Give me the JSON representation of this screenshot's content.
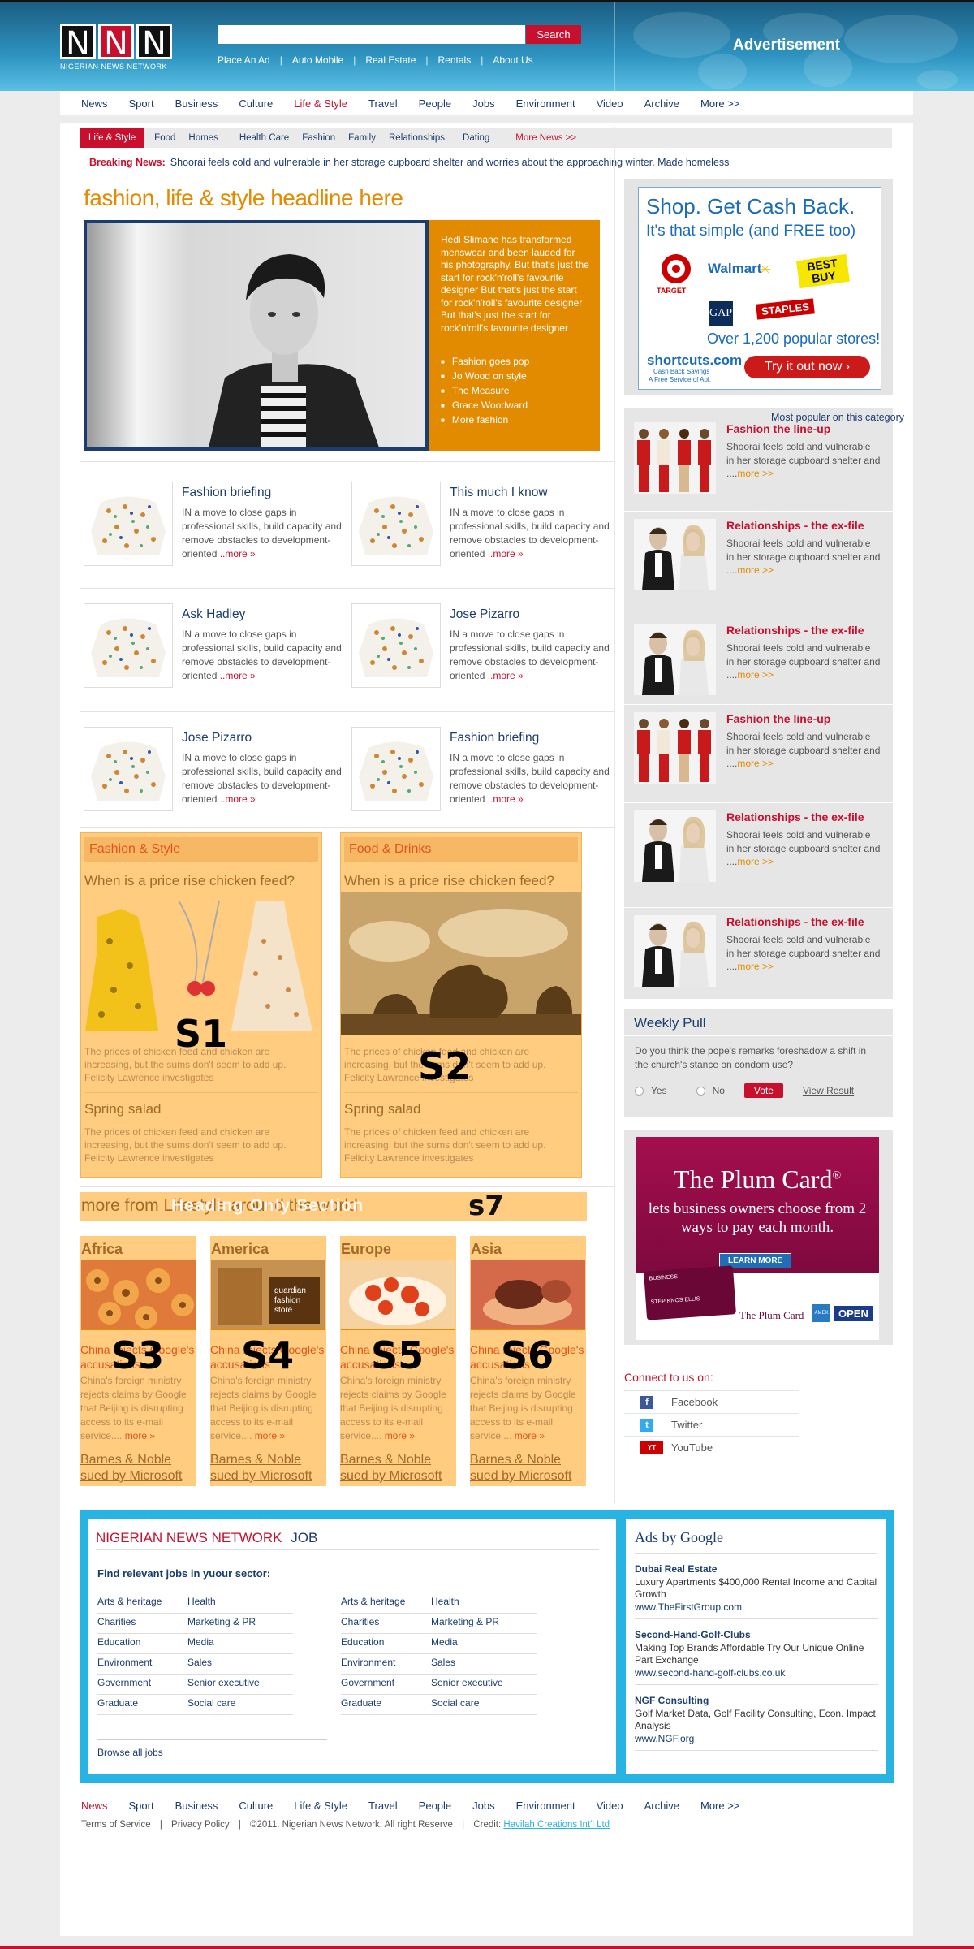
{
  "header": {
    "logo_letters": [
      "N",
      "N",
      "N"
    ],
    "logo_sub": "NIGERIAN NEWS NETWORK",
    "search_button": "Search",
    "search_value": "",
    "top_links": [
      "Place An Ad",
      "Auto Mobile",
      "Real Estate",
      "Rentals",
      "About Us"
    ],
    "advertisement": "Advertisement"
  },
  "main_nav": [
    "News",
    "Sport",
    "Business",
    "Culture",
    "Life & Style",
    "Travel",
    "People",
    "Jobs",
    "Environment",
    "Video",
    "Archive",
    "More >>"
  ],
  "main_nav_active": "Life & Style",
  "sub_nav": {
    "active": "Life & Style",
    "items": [
      "Food",
      "Homes",
      "Health Care",
      "Fashion",
      "Family",
      "Relationships",
      "Dating"
    ],
    "more": "More News >>"
  },
  "breaking": {
    "label": "Breaking News:",
    "text": "Shoorai feels cold and vulnerable in her storage cupboard shelter and worries about the approaching winter. Made homeless"
  },
  "feature": {
    "headline": "fashion, life  & style headline here",
    "text": "Hedi Slimane has transformed menswear and been lauded for his photography. But that's just the start for rock'n'roll's favourite designer But that's just the start for rock'n'roll's favourite designer But that's just the start for rock'n'roll's favourite designer",
    "links": [
      "Fashion goes pop",
      "Jo Wood on style",
      "The Measure",
      "Grace Woodward",
      "More fashion"
    ]
  },
  "stories": [
    {
      "title": "Fashion briefing",
      "body": "IN a move to close gaps in professional skills, build capacity and remove obstacles to development-oriented ",
      "more": "..more »"
    },
    {
      "title": "This much I know",
      "body": "IN a move to close gaps in professional skills, build capacity and remove obstacles to development-oriented ",
      "more": "..more »"
    },
    {
      "title": "Ask Hadley",
      "body": "IN a move to close gaps in professional skills, build capacity and remove obstacles to development-oriented ",
      "more": "..more »"
    },
    {
      "title": "Jose Pizarro",
      "body": "IN a move to close gaps in professional skills, build capacity and remove obstacles to development-oriented ",
      "more": "..more »"
    },
    {
      "title": "Jose Pizarro",
      "body": "IN a move to close gaps in professional skills, build capacity and remove obstacles to development-oriented ",
      "more": "..more »"
    },
    {
      "title": "Fashion briefing",
      "body": "IN a move to close gaps in professional skills, build capacity and remove obstacles to development-oriented ",
      "more": "..more »"
    }
  ],
  "panels": [
    {
      "head": "Fashion & Style",
      "question": "When is a price rise chicken feed?",
      "body": "The prices of chicken feed and chicken are increasing, but the sums don't seem to add up. Felicity Lawrence investigates",
      "sub": "Spring salad",
      "sub_body": "The prices of chicken feed and chicken are increasing, but the sums don't seem to add up. Felicity Lawrence investigates",
      "label": "S1"
    },
    {
      "head": "Food & Drinks",
      "question": "When is a price rise chicken feed?",
      "body": "The prices of chicken feed and chicken are increasing, but the sums don't seem to add up. Felicity Lawrence investigates",
      "sub": "Spring salad",
      "sub_body": "The prices of chicken feed and chicken are increasing, but the sums don't seem to add up. Felicity Lawrence investigates",
      "label": "S2"
    }
  ],
  "world": {
    "title": "more from Lifestyle around the world",
    "overlay": "Heading Only Section",
    "label": "s7",
    "continents": [
      {
        "name": "Africa",
        "title": "China rejects Google's accusations",
        "body": "China's foreign ministry rejects claims by Google that Beijing is disrupting access to its e-mail service.... ",
        "more": "more »",
        "foot": "Barnes & Noble sued by Microsoft",
        "label": "S3"
      },
      {
        "name": "America",
        "title": "China rejects Google's accusations",
        "body": "China's foreign ministry rejects claims by Google that Beijing is disrupting access to its e-mail service.... ",
        "more": "more »",
        "foot": "Barnes & Noble sued by Microsoft",
        "label": "S4",
        "img_text": "guardian fashion store"
      },
      {
        "name": "Europe",
        "title": "China rejects Google's accusations",
        "body": "China's foreign ministry rejects claims by Google that Beijing is disrupting access to its e-mail service.... ",
        "more": "more »",
        "foot": "Barnes & Noble sued by Microsoft",
        "label": "S5"
      },
      {
        "name": "Asia",
        "title": "China rejects Google's accusations",
        "body": "China's foreign ministry rejects claims by Google that Beijing is disrupting access to its e-mail service.... ",
        "more": "more »",
        "foot": "Barnes & Noble sued by Microsoft",
        "label": "S6"
      }
    ]
  },
  "shortcuts_ad": {
    "line1": "Shop. Get Cash Back.",
    "line2": "It's that simple (and FREE too)",
    "brands": [
      "TARGET",
      "Walmart",
      "BEST BUY",
      "GAP",
      "STAPLES"
    ],
    "stores": "Over 1,200 popular stores!",
    "logo": "shortcuts.com",
    "logo_sub": "Cash Back Savings",
    "logo_sub2": "A Free Service of Aol.",
    "cta": "Try it out now ›"
  },
  "popular": {
    "heading": "Most popular on this category",
    "items": [
      {
        "title": "Fashion the line-up",
        "body": "Shoorai feels cold and vulnerable in her storage cupboard shelter and ....",
        "more": "more >>",
        "kind": "lineup"
      },
      {
        "title": "Relationships - the ex-file",
        "body": "Shoorai feels cold and vulnerable in her storage cupboard shelter and ....",
        "more": "more >>",
        "kind": "couple"
      },
      {
        "title": "Relationships - the ex-file",
        "body": "Shoorai feels cold and vulnerable in her storage cupboard shelter and ....",
        "more": "more >>",
        "kind": "couple"
      },
      {
        "title": "Fashion the line-up",
        "body": "Shoorai feels cold and vulnerable in her storage cupboard shelter and ....",
        "more": "more >>",
        "kind": "lineup"
      },
      {
        "title": "Relationships - the ex-file",
        "body": "Shoorai feels cold and vulnerable in her storage cupboard shelter and ....",
        "more": "more >>",
        "kind": "couple"
      },
      {
        "title": "Relationships - the ex-file",
        "body": "Shoorai feels cold and vulnerable in her storage cupboard shelter and ....",
        "more": "more >>",
        "kind": "couple"
      }
    ]
  },
  "poll": {
    "title": "Weekly Pull",
    "question": "Do you think the pope's remarks foreshadow a shift in the church's stance on condom use?",
    "yes": "Yes",
    "no": "No",
    "vote": "Vote",
    "view": "View Result"
  },
  "plum": {
    "title": "The Plum Card",
    "reg": "®",
    "text": "lets business owners choose from 2 ways to pay each month.",
    "learn": "LEARN MORE",
    "card_label": "BUSINESS",
    "card_name": "STEP KNOS ELLIS",
    "card_footer": "The Plum Card",
    "open": "OPEN"
  },
  "connect": {
    "heading": "Connect to us on:",
    "links": [
      "Facebook",
      "Twitter",
      "YouTube"
    ]
  },
  "jobs": {
    "brand": "NIGERIAN NEWS NETWORK",
    "label": "JOB",
    "sector": "Find relevant jobs in yuour sector:",
    "col1": [
      "Arts & heritage",
      "Charities",
      "Education",
      "Environment",
      "Government",
      "Graduate"
    ],
    "col2": [
      "Health",
      "Marketing & PR",
      "Media",
      "Sales",
      "Senior executive",
      "Social care"
    ],
    "col3": [
      "Arts & heritage",
      "Charities",
      "Education",
      "Environment",
      "Government",
      "Graduate"
    ],
    "col4": [
      "Health",
      "Marketing & PR",
      "Media",
      "Sales",
      "Senior executive",
      "Social care"
    ],
    "browse": "Browse all jobs"
  },
  "google_ads": {
    "title": "Ads by Google",
    "ads": [
      {
        "name": "Dubai Real Estate",
        "text": "Luxury Apartments $400,000 Rental Income and Capital Growth",
        "url": "www.TheFirstGroup.com"
      },
      {
        "name": "Second-Hand-Golf-Clubs",
        "text": "Making Top Brands Affordable Try Our Unique Online Part Exchange",
        "url": "www.second-hand-golf-clubs.co.uk"
      },
      {
        "name": "NGF Consulting",
        "text": "Golf Market Data, Golf Facility Consulting, Econ. Impact Analysis",
        "url": "www.NGF.org"
      }
    ]
  },
  "footer": {
    "nav": [
      "News",
      "Sport",
      "Business",
      "Culture",
      "Life & Style",
      "Travel",
      "People",
      "Jobs",
      "Environment",
      "Video",
      "Archive",
      "More >>"
    ],
    "terms": "Terms of Service",
    "privacy": "Privacy Policy",
    "copyright": "©2011. Nigerian News Network. All right Reserve",
    "credit_label": "Credit:",
    "credit_link": "Havilah Creations Int'l Ltd"
  },
  "colors": {
    "brand_red": "#c8102e",
    "navy": "#1a3c6e",
    "orange": "#e38b00",
    "cyan": "#27b4e3",
    "peach": "#ffcc80"
  }
}
